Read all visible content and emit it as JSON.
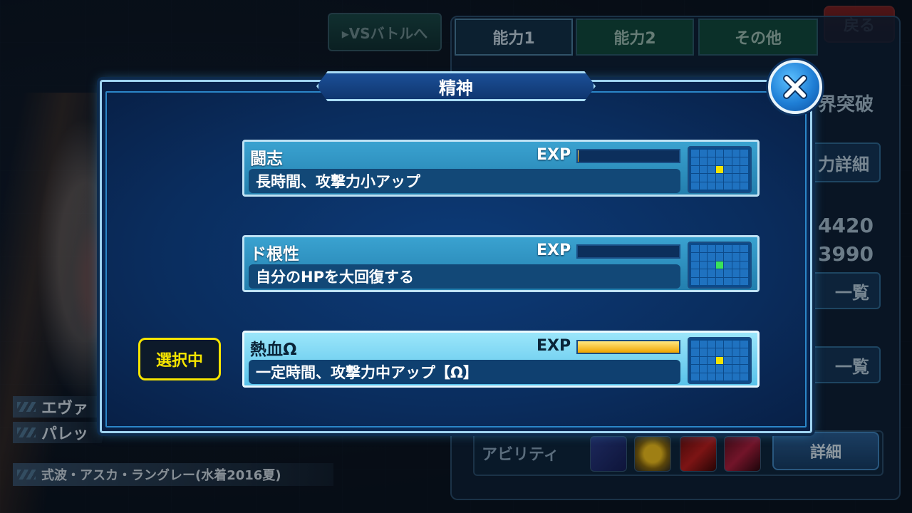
{
  "background": {
    "vs_battle_label": "▸VSバトルへ",
    "back_label": "戻る",
    "tabs": [
      "能力1",
      "能力2",
      "その他"
    ],
    "limit_break_label": "界突破",
    "ability_detail_label": "力詳細",
    "stats": [
      "4420",
      "3990"
    ],
    "list_label_1": "一覧",
    "list_label_2": "一覧",
    "ability_label": "アビリティ",
    "detail_label": "詳細",
    "character_tags": [
      "エヴァ",
      "パレッ"
    ],
    "character_name": "式波・アスカ・ラングレー(水着2016夏)"
  },
  "modal": {
    "title": "精神",
    "selected_badge": "選択中",
    "skills": [
      {
        "name": "闘志",
        "exp_label": "EXP",
        "exp_progress": 0.01,
        "description": "長時間、攻撃力小アップ",
        "marker_color": "#f5e400",
        "selected": false
      },
      {
        "name": "ド根性",
        "exp_label": "EXP",
        "exp_progress": 0.0,
        "description": "自分のHPを大回復する",
        "marker_color": "#39e35a",
        "selected": false
      },
      {
        "name": "熱血Ω",
        "exp_label": "EXP",
        "exp_progress": 1.0,
        "description": "一定時間、攻撃力中アップ【Ω】",
        "marker_color": "#f5e400",
        "selected": true
      }
    ]
  },
  "colors": {
    "modal_bg": "#0a2d5e",
    "selected_accent": "#f5e400",
    "exp_fill": "#f0a400"
  }
}
